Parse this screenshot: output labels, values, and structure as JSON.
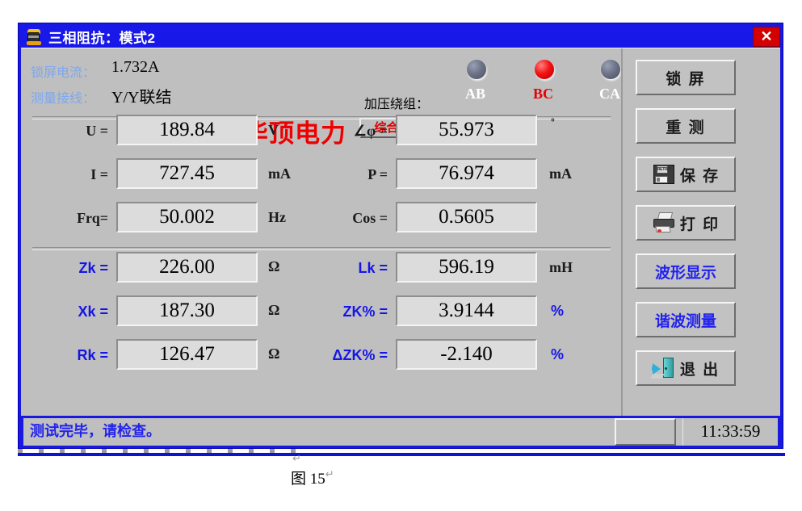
{
  "window": {
    "title": "三相阻抗：模式2",
    "icon": "device-icon",
    "close_label": "✕"
  },
  "header": {
    "current_label": "锁屏电流：",
    "current_value": "1.732A",
    "wiring_label": "测量接线：",
    "wiring_value": "Y/Y联结",
    "watermark": "华顶电力",
    "calc_button": "综合计算",
    "winding_label": "加压绕组：",
    "leds": [
      {
        "caption": "AB",
        "state": "off"
      },
      {
        "caption": "BC",
        "state": "on"
      },
      {
        "caption": "CA",
        "state": "off"
      }
    ]
  },
  "measurements": {
    "primary": [
      {
        "label": "U =",
        "value": "189.84",
        "unit": "V"
      },
      {
        "label": "I =",
        "value": "727.45",
        "unit": "mA"
      },
      {
        "label": "Frq=",
        "value": "50.002",
        "unit": "Hz"
      }
    ],
    "primary_right": [
      {
        "label": "∠φ =",
        "value": "55.973",
        "unit": "°"
      },
      {
        "label": "P =",
        "value": "76.974",
        "unit": "mA"
      },
      {
        "label": "Cos =",
        "value": "0.5605",
        "unit": ""
      }
    ],
    "secondary": [
      {
        "label": "Zk =",
        "value": "226.00",
        "unit": "Ω"
      },
      {
        "label": "Xk =",
        "value": "187.30",
        "unit": "Ω"
      },
      {
        "label": "Rk =",
        "value": "126.47",
        "unit": "Ω"
      }
    ],
    "secondary_right": [
      {
        "label": "Lk =",
        "value": "596.19",
        "unit": "mH"
      },
      {
        "label": "ZK% =",
        "value": "3.9144",
        "unit": "%"
      },
      {
        "label": "ΔZK% =",
        "value": "-2.140",
        "unit": "%"
      }
    ]
  },
  "sidebar": {
    "buttons": [
      {
        "label": "锁 屏",
        "icon": "",
        "style": "black"
      },
      {
        "label": "重 测",
        "icon": "",
        "style": "black"
      },
      {
        "label": "保 存",
        "icon": "floppy-icon",
        "style": "black"
      },
      {
        "label": "打 印",
        "icon": "printer-icon",
        "style": "black"
      },
      {
        "label": "波形显示",
        "icon": "",
        "style": "blue"
      },
      {
        "label": "谐波测量",
        "icon": "",
        "style": "blue"
      },
      {
        "label": "退 出",
        "icon": "exit-icon",
        "style": "black"
      }
    ]
  },
  "statusbar": {
    "message": "测试完毕，请检查。",
    "time": "11:33:59"
  },
  "document": {
    "caption": "图 15",
    "pilcrow": "↵"
  },
  "colors": {
    "window_border": "#1818e0",
    "client_bg": "#bfbfbf",
    "accent_red": "#e00000",
    "accent_blue": "#2222ee",
    "label_blue": "#7da7ef"
  }
}
